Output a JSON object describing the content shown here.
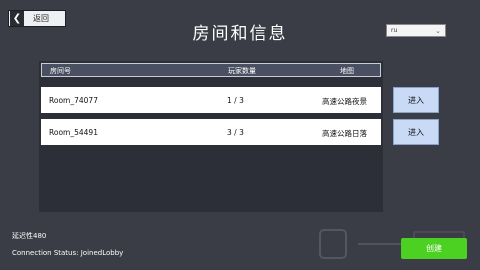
{
  "back_button": {
    "icon": "chevron-left-icon",
    "label": "返回"
  },
  "title": "房间和信息",
  "language_select": {
    "value": "ru"
  },
  "table": {
    "columns": [
      "房间号",
      "玩家数量",
      "地图"
    ],
    "rows": [
      {
        "room": "Room_74077",
        "players": "1 / 3",
        "map": "高速公路夜景",
        "join_label": "进入"
      },
      {
        "room": "Room_54491",
        "players": "3 / 3",
        "map": "高速公路日落",
        "join_label": "进入"
      }
    ]
  },
  "status": {
    "delay": "延迟性480",
    "connection": "Connection Status: JoinedLobby"
  },
  "create_button": {
    "label": "创建"
  },
  "colors": {
    "background": "#3a3c46",
    "table_header": "#4a5062",
    "join_button": "#c9daf7",
    "create_button": "#4cd021"
  }
}
